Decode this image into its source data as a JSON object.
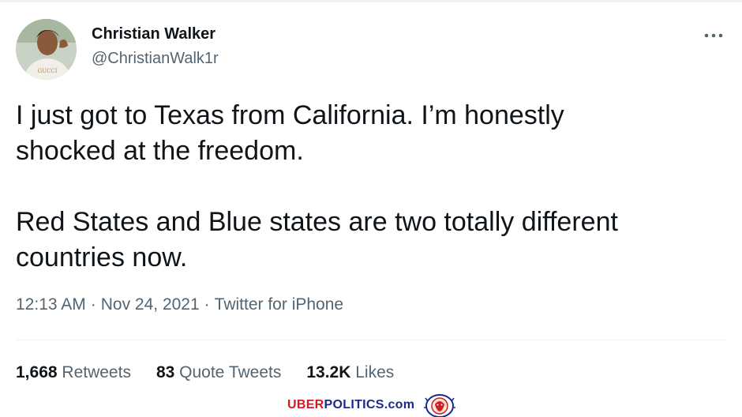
{
  "author": {
    "display_name": "Christian Walker",
    "handle": "@ChristianWalk1r",
    "avatar_shirt_text": "GUCCI"
  },
  "tweet": {
    "text": "I just got to Texas from California. I’m honestly\nshocked at the freedom.\n\nRed States and Blue states are two totally different\ncountries now."
  },
  "meta": {
    "time": "12:13 AM",
    "date": "Nov 24, 2021",
    "separator": "·",
    "source": "Twitter for iPhone"
  },
  "stats": [
    {
      "count": "1,668",
      "label": "Retweets"
    },
    {
      "count": "83",
      "label": "Quote Tweets"
    },
    {
      "count": "13.2K",
      "label": "Likes"
    }
  ],
  "watermark": {
    "part1": "UBER",
    "part2": "POLITICS",
    "part3": ".com",
    "colors": {
      "red": "#d71a21",
      "blue": "#1a2a8c"
    }
  },
  "icons": {
    "more": "more-horizontal-icon",
    "logo": "lion-crest-icon"
  },
  "colors": {
    "text_primary": "#0f1419",
    "text_secondary": "#536471",
    "divider": "#eff3f4"
  }
}
